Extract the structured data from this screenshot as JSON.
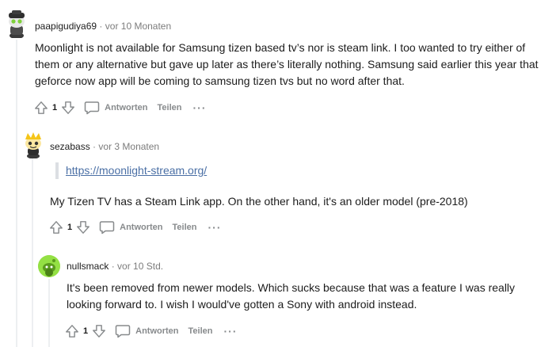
{
  "comments": [
    {
      "username": "paapigudiya69",
      "separator": "·",
      "time": "vor 10 Monaten",
      "body": "Moonlight is not available for Samsung tizen based tv’s nor is steam link. I too wanted to try either of them or any alternative but gave up later as there’s literally nothing. Samsung said earlier this year that geforce now app will be coming to samsung tizen tvs but no word after that.",
      "score": "1",
      "reply_label": "Antworten",
      "share_label": "Teilen",
      "more_label": "···"
    },
    {
      "username": "sezabass",
      "separator": "·",
      "time": "vor 3 Monaten",
      "quote_link": "https://moonlight-stream.org/",
      "body": "My Tizen TV has a Steam Link app. On the other hand, it's an older model (pre-2018)",
      "score": "1",
      "reply_label": "Antworten",
      "share_label": "Teilen",
      "more_label": "···"
    },
    {
      "username": "nullsmack",
      "separator": "·",
      "time": "vor 10 Std.",
      "body": "It's been removed from newer models. Which sucks because that was a feature I was really looking forward to. I wish I would've gotten a Sony with android instead.",
      "score": "1",
      "reply_label": "Antworten",
      "share_label": "Teilen",
      "more_label": "···"
    }
  ],
  "colors": {
    "link": "#4a6fa5",
    "meta": "#7c7c7c",
    "action": "#878a8c",
    "thread": "#edeff1"
  }
}
